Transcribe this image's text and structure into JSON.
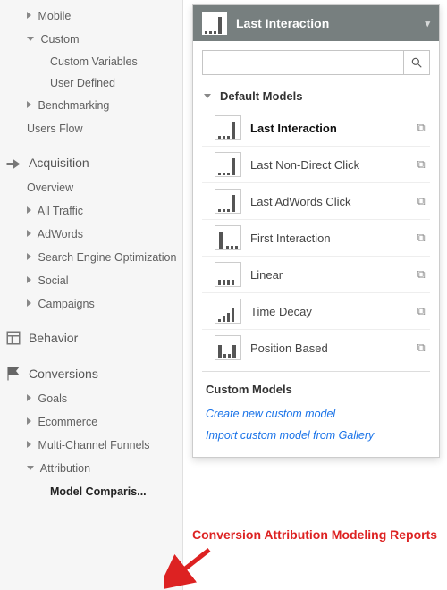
{
  "sidebar": {
    "audience_children": {
      "mobile": "Mobile",
      "custom": "Custom",
      "custom_vars": "Custom Variables",
      "user_defined": "User Defined",
      "benchmarking": "Benchmarking",
      "users_flow": "Users Flow"
    },
    "acquisition": {
      "label": "Acquisition",
      "overview": "Overview",
      "all_traffic": "All Traffic",
      "adwords": "AdWords",
      "seo": "Search Engine Optimization",
      "social": "Social",
      "campaigns": "Campaigns"
    },
    "behavior": {
      "label": "Behavior"
    },
    "conversions": {
      "label": "Conversions",
      "goals": "Goals",
      "ecommerce": "Ecommerce",
      "mcf": "Multi-Channel Funnels",
      "attribution": "Attribution",
      "model_comparison": "Model Comparis..."
    }
  },
  "panel": {
    "selected_label": "Last Interaction",
    "search_placeholder": "",
    "default_header": "Default Models",
    "custom_header": "Custom Models",
    "models": [
      {
        "id": "last",
        "label": "Last Interaction",
        "icon": "last",
        "copy": true,
        "selected": true
      },
      {
        "id": "lnd",
        "label": "Last Non-Direct Click",
        "icon": "last",
        "copy": true
      },
      {
        "id": "law",
        "label": "Last AdWords Click",
        "icon": "last",
        "copy": true
      },
      {
        "id": "first",
        "label": "First Interaction",
        "icon": "first",
        "copy": true
      },
      {
        "id": "linear",
        "label": "Linear",
        "icon": "linear",
        "copy": true
      },
      {
        "id": "decay",
        "label": "Time Decay",
        "icon": "decay",
        "copy": true
      },
      {
        "id": "pos",
        "label": "Position Based",
        "icon": "position",
        "copy": true
      }
    ],
    "create_label": "Create new custom model",
    "import_label": "Import custom model from Gallery"
  },
  "annotation": "Conversion Attribution Modeling Reports"
}
